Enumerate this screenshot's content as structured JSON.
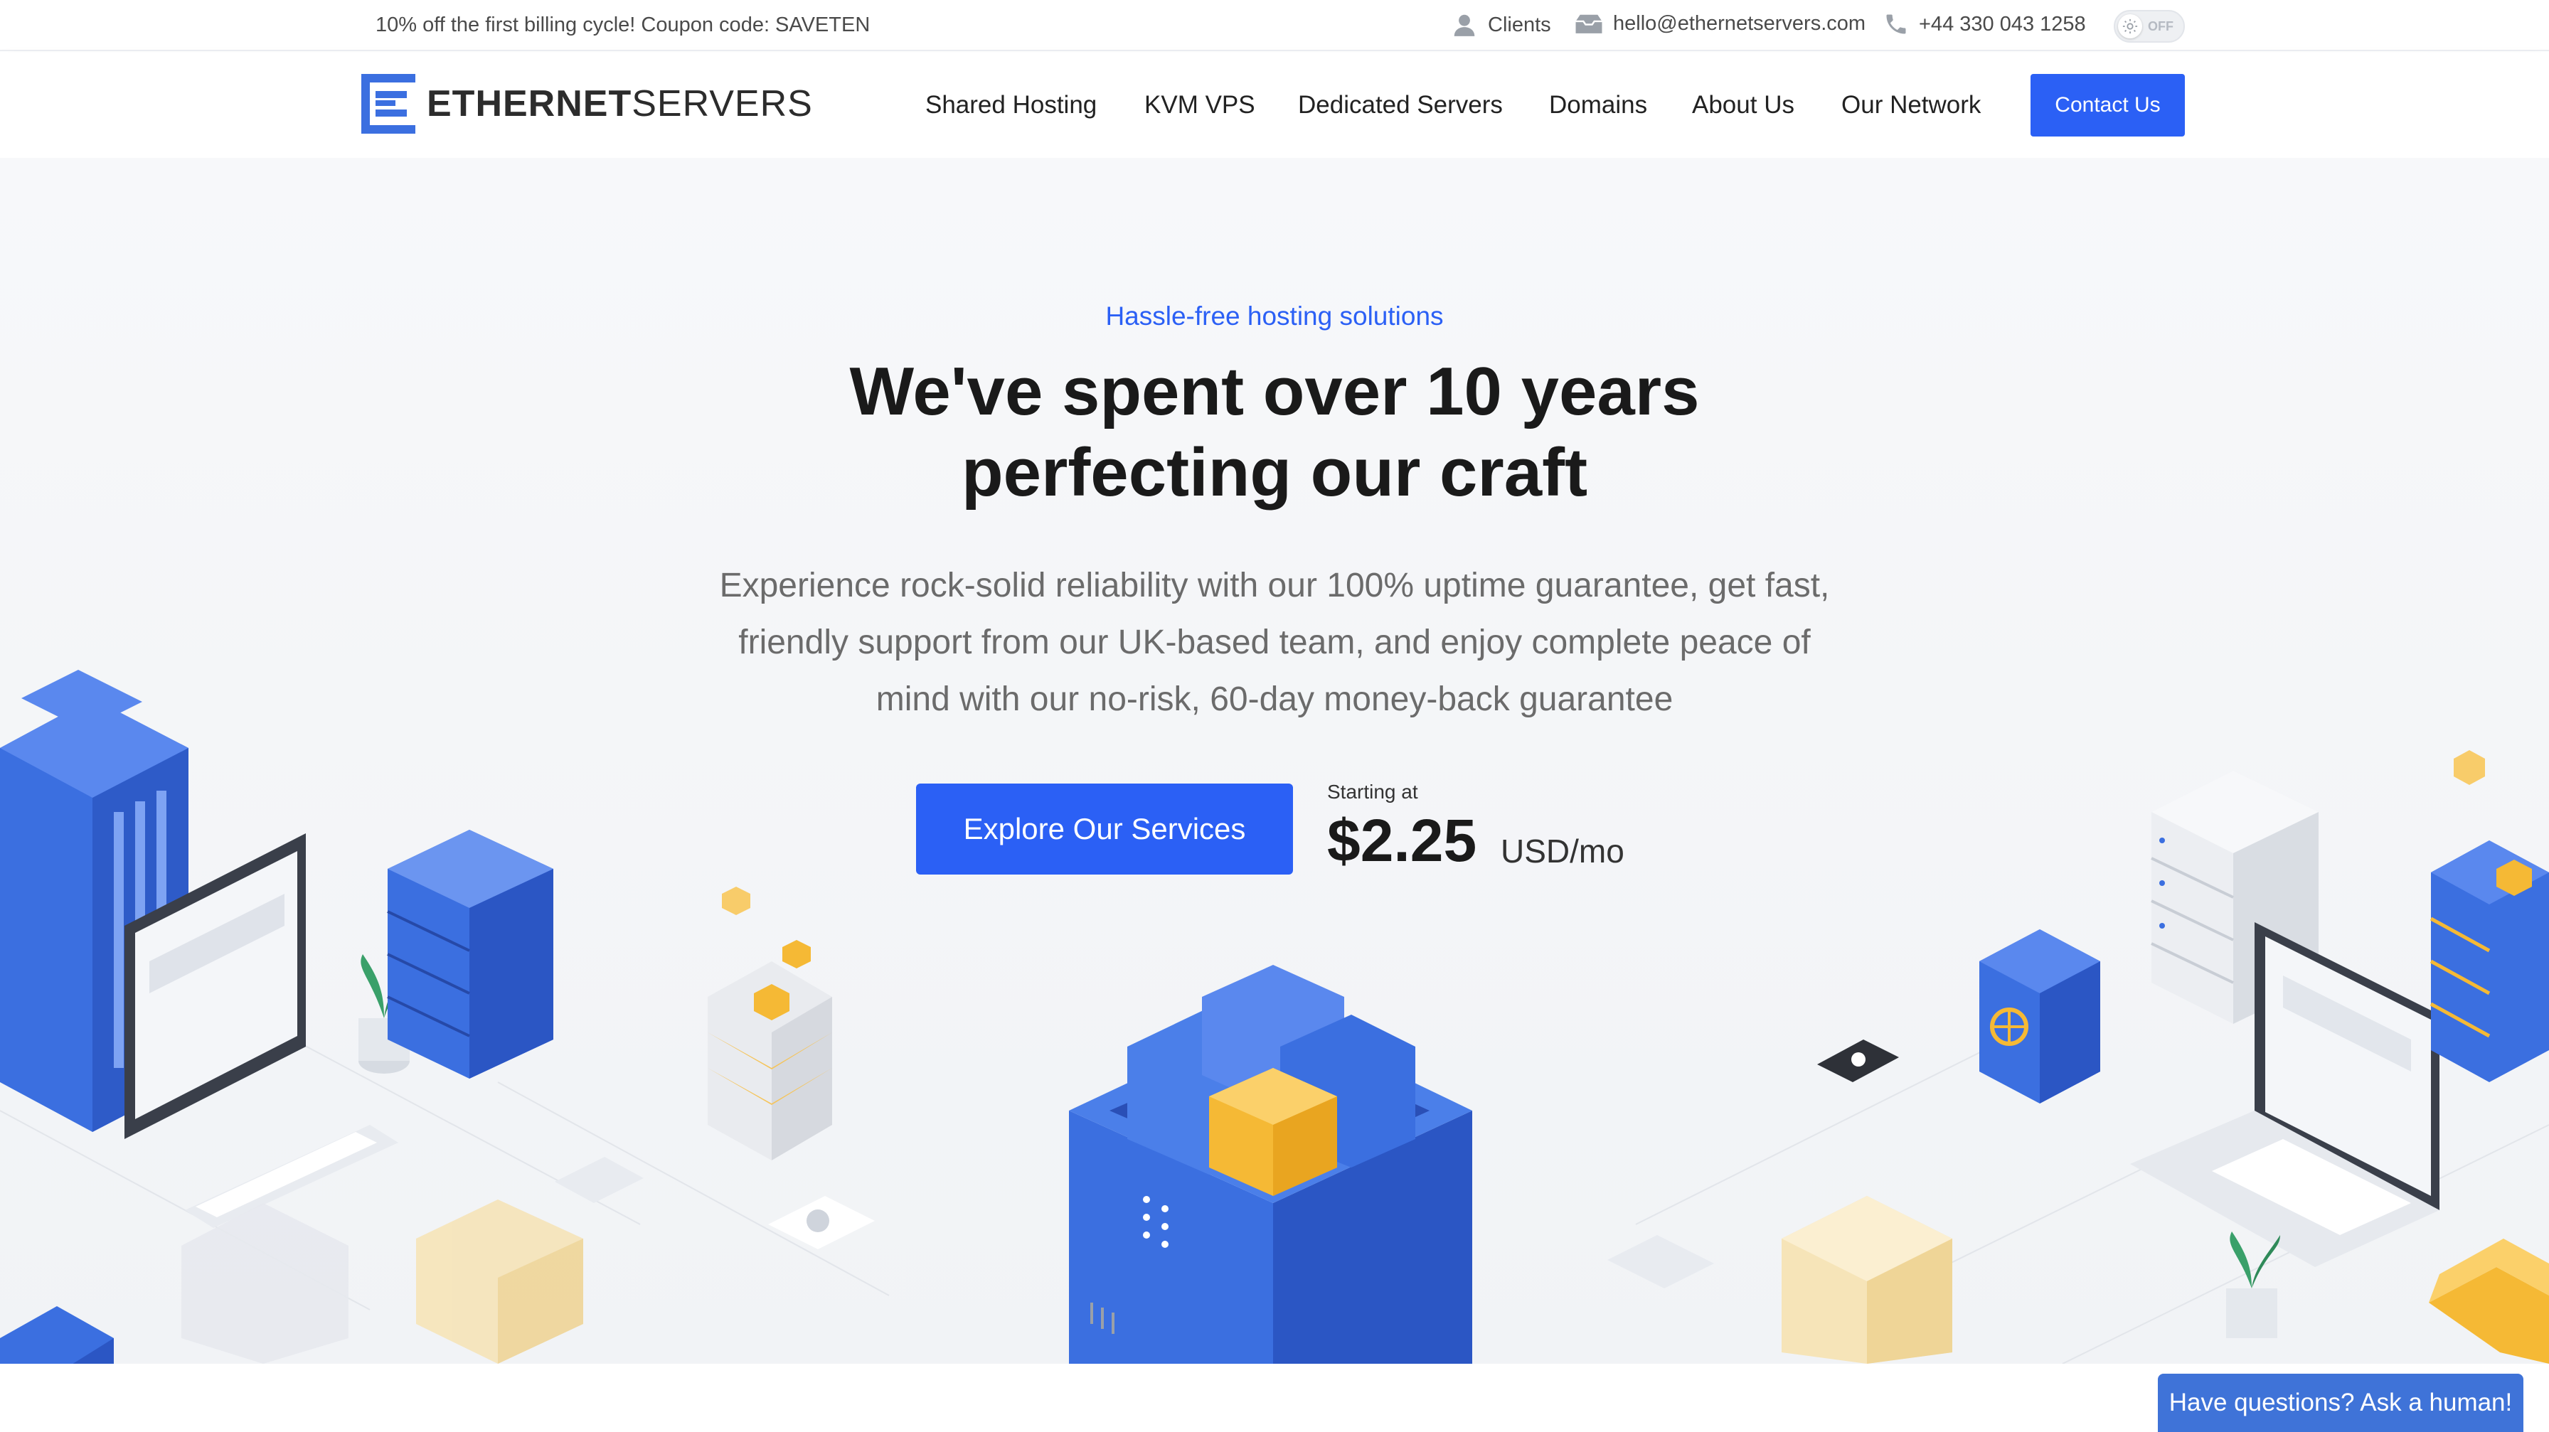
{
  "topbar": {
    "promo": "10% off the first billing cycle! Coupon code: SAVETEN",
    "clients_label": "Clients",
    "email": "hello@ethernetservers.com",
    "phone": "+44 330 043 1258",
    "theme_toggle_label": "OFF",
    "icons": [
      "user-icon",
      "mail-icon",
      "phone-icon",
      "sun-icon"
    ]
  },
  "header": {
    "logo_bold": "ETHERNET",
    "logo_light": "SERVERS",
    "nav": [
      "Shared Hosting",
      "KVM VPS",
      "Dedicated Servers",
      "Domains",
      "About Us",
      "Our Network"
    ],
    "contact_label": "Contact Us"
  },
  "hero": {
    "eyebrow": "Hassle-free hosting solutions",
    "headline_line1": "We've spent over 10 years",
    "headline_line2": "perfecting our craft",
    "subtext": "Experience rock-solid reliability with our 100% uptime guarantee, get fast, friendly support from our UK-based team, and enjoy complete peace of mind with our no-risk, 60-day money-back guarantee",
    "cta_label": "Explore Our Services",
    "starting_label": "Starting at",
    "price": "$2.25",
    "price_unit": "USD/mo"
  },
  "chat": {
    "label": "Have questions? Ask a human!"
  },
  "colors": {
    "accent": "#2b60f5",
    "chat": "#3f73d8",
    "illustration_blue": "#3b6fe0",
    "illustration_gold": "#f5b935"
  }
}
